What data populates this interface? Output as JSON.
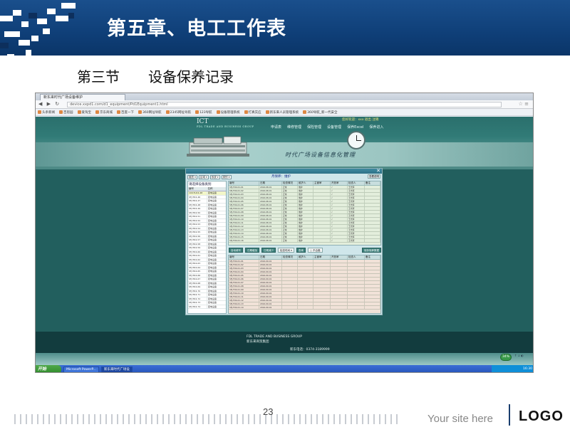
{
  "slide": {
    "chapter_title": "第五章、电工工作表",
    "section_number": "第三节",
    "section_title": "设备保养记录",
    "page_number": "23",
    "site_text": "Your site here",
    "logo_text": "LOGO"
  },
  "browser": {
    "tab_title": "新东来时代广场设备维护",
    "url": "device.xxpd1.com/d1_equipment/Pd1Equipment1.html",
    "bookmarks": [
      "头条新闻",
      "百思园",
      "爱淘宝",
      "京东商城",
      "百度一下",
      "360网址导航",
      "2345网址导航",
      "123导航",
      "设备管理系统",
      "打真实应",
      "新东来人员管理系统",
      "360导航_新一代安全"
    ]
  },
  "site": {
    "logo": "ICT",
    "logo_sub": "FDL TRADE AND BUSINESS GROUP",
    "login_info": "您好欢迎：xxx 退出 注销",
    "menu": [
      "申请表",
      "维修管理",
      "保险管理",
      "设备管理",
      "保养Excel",
      "保养进入"
    ],
    "slogan": "时代广场设备信息化管理",
    "footer_line1": "FDL TRADE AND BUSINESS GROUP",
    "footer_line2": "新东来商贸集团",
    "footer_tel": "新东电话：0374-3189999"
  },
  "app": {
    "toolbar": [
      "楼层",
      "区域",
      "系统",
      "类别"
    ],
    "current_label": "月保养：维护",
    "announce_button": "查看说明",
    "left_title": "请选择设备类别",
    "left_headers": [
      "编号",
      "名称"
    ],
    "left_rows": [
      [
        "100-TLD4-48",
        "配电设备"
      ],
      [
        "SFJ-TD4-46",
        "配电设备"
      ],
      [
        "SFJ-TD4-47",
        "配电设备"
      ],
      [
        "SFJ-TD4-48",
        "配电设备"
      ],
      [
        "SFJ-TD4-49",
        "配电设备"
      ],
      [
        "SFJ-TD4-50",
        "配电设备"
      ],
      [
        "SFJ-TD4-51",
        "配电设备"
      ],
      [
        "SFJ-TD4-52",
        "配电设备"
      ],
      [
        "SFJ-TD4-53",
        "配电设备"
      ],
      [
        "SFJ-TD4-54",
        "配电设备"
      ],
      [
        "SFJ-TD4-55",
        "配电设备"
      ],
      [
        "SFJ-TD4-56",
        "配电设备"
      ],
      [
        "SFJ-TD4-57",
        "配电设备"
      ],
      [
        "SFJ-TD4-58",
        "配电设备"
      ],
      [
        "SFJ-TD4-59",
        "配电设备"
      ],
      [
        "SFJ-TD4-60",
        "配电设备"
      ],
      [
        "SFJ-TD4-61",
        "配电设备"
      ],
      [
        "SFJ-TD4-62",
        "配电设备"
      ],
      [
        "SFJ-TD4-63",
        "配电设备"
      ],
      [
        "SFJ-TD4-64",
        "配电设备"
      ],
      [
        "SFJ-TD4-65",
        "配电设备"
      ],
      [
        "SFJ-TD4-66",
        "配电设备"
      ],
      [
        "SFJ-TD4-67",
        "配电设备"
      ],
      [
        "SFJ-TD4-68",
        "配电设备"
      ],
      [
        "SFJ-TD4-69",
        "配电设备"
      ],
      [
        "SFJ-TD4-70",
        "配电设备"
      ],
      [
        "SFJ-TD4-71",
        "配电设备"
      ],
      [
        "SFJ-TD4-72",
        "配电设备"
      ],
      [
        "SFJ-TD4-73",
        "配电设备"
      ],
      [
        "SFJ-TD4-74",
        "配电设备"
      ]
    ],
    "grid_headers": [
      "编号",
      "日期",
      "检查情况",
      "维护人",
      "主管审",
      "开放审",
      "检查人",
      "备注"
    ],
    "top_rows": [
      [
        "SFJ-TD4-01-01",
        "2016-08-01",
        "正常",
        "维护",
        "",
        "√",
        "王光辉",
        ""
      ],
      [
        "SFJ-TD4-01-02",
        "2016-08-01",
        "正常",
        "维护",
        "",
        "√",
        "王光辉",
        ""
      ],
      [
        "SFJ-TD4-01-03",
        "2016-08-01",
        "正常",
        "维护",
        "",
        "√",
        "王光辉",
        ""
      ],
      [
        "SFJ-TD4-01-04",
        "2016-08-01",
        "正常",
        "维护",
        "",
        "√",
        "王光辉",
        ""
      ],
      [
        "SFJ-TD4-01-05",
        "2016-08-01",
        "正常",
        "维护",
        "",
        "√",
        "王光辉",
        ""
      ],
      [
        "SFJ-TD4-01-06",
        "2016-08-01",
        "正常",
        "维护",
        "",
        "√",
        "王光辉",
        ""
      ],
      [
        "SFJ-TD4-01-07",
        "2016-08-01",
        "正常",
        "维护",
        "",
        "√",
        "王光辉",
        ""
      ],
      [
        "SFJ-TD4-01-08",
        "2016-08-01",
        "正常",
        "维护",
        "",
        "√",
        "王光辉",
        ""
      ],
      [
        "SFJ-TD4-01-09",
        "2016-08-01",
        "正常",
        "维护",
        "",
        "√",
        "王光辉",
        ""
      ],
      [
        "SFJ-TD4-01-10",
        "2016-08-01",
        "正常",
        "维护",
        "",
        "√",
        "王光辉",
        ""
      ],
      [
        "SFJ-TD4-01-11",
        "2016-08-01",
        "正常",
        "维护",
        "",
        "√",
        "王光辉",
        ""
      ],
      [
        "SFJ-TD4-01-12",
        "2016-08-01",
        "正常",
        "维护",
        "",
        "√",
        "王光辉",
        ""
      ],
      [
        "SFJ-TD4-01-13",
        "2016-08-01",
        "正常",
        "维护",
        "",
        "√",
        "王光辉",
        ""
      ],
      [
        "SFJ-TD4-01-14",
        "2016-08-01",
        "正常",
        "维护",
        "",
        "√",
        "王光辉",
        ""
      ],
      [
        "SFJ-TD4-01-15",
        "2016-08-01",
        "正常",
        "维护",
        "",
        "√",
        "王光辉",
        ""
      ],
      [
        "SFJ-TD4-01-16",
        "2016-08-01",
        "正常",
        "维护",
        "",
        "√",
        "王光辉",
        ""
      ]
    ],
    "action_buttons": [
      "自动填写",
      "日期增加",
      "日期减少"
    ],
    "time_select": "检查时间",
    "query_button": "查询",
    "radio_label": "不合格",
    "submit_button": "保存保养数据",
    "bottom_rows": [
      [
        "SFJ-TD4-01-01",
        "2016-09-01",
        "",
        "",
        "",
        "",
        "",
        ""
      ],
      [
        "SFJ-TD4-01-02",
        "2016-09-01",
        "",
        "",
        "",
        "",
        "",
        ""
      ],
      [
        "SFJ-TD4-01-03",
        "2016-09-01",
        "",
        "",
        "",
        "",
        "",
        ""
      ],
      [
        "SFJ-TD4-01-04",
        "2016-09-01",
        "",
        "",
        "",
        "",
        "",
        ""
      ],
      [
        "SFJ-TD4-01-05",
        "2016-09-01",
        "",
        "",
        "",
        "",
        "",
        ""
      ],
      [
        "SFJ-TD4-01-06",
        "2016-09-01",
        "",
        "",
        "",
        "",
        "",
        ""
      ],
      [
        "SFJ-TD4-01-07",
        "2016-09-01",
        "",
        "",
        "",
        "",
        "",
        ""
      ],
      [
        "SFJ-TD4-01-08",
        "2016-09-01",
        "",
        "",
        "",
        "",
        "",
        ""
      ],
      [
        "SFJ-TD4-01-09",
        "2016-09-01",
        "",
        "",
        "",
        "",
        "",
        ""
      ],
      [
        "SFJ-TD4-01-10",
        "2016-09-01",
        "",
        "",
        "",
        "",
        "",
        ""
      ],
      [
        "SFJ-TD4-01-11",
        "2016-09-01",
        "",
        "",
        "",
        "",
        "",
        ""
      ],
      [
        "SFJ-TD4-01-12",
        "2016-09-01",
        "",
        "",
        "",
        "",
        "",
        ""
      ],
      [
        "SFJ-TD4-01-13",
        "2016-09-01",
        "",
        "",
        "",
        "",
        "",
        ""
      ],
      [
        "SFJ-TD4-01-14",
        "2016-09-01",
        "",
        "",
        "",
        "",
        "",
        ""
      ]
    ]
  },
  "taskbar": {
    "start_label": "开始",
    "tasks": [
      "Microsoft PowerP...",
      "新东来时代广场设"
    ],
    "tray_time": "16:30",
    "badge": "34%"
  },
  "colors": {
    "header_blue": "#0f3f78",
    "site_teal": "#225f5e",
    "grid_top_bg": "#e3eedc",
    "grid_bottom_bg": "#f1e2d8"
  }
}
